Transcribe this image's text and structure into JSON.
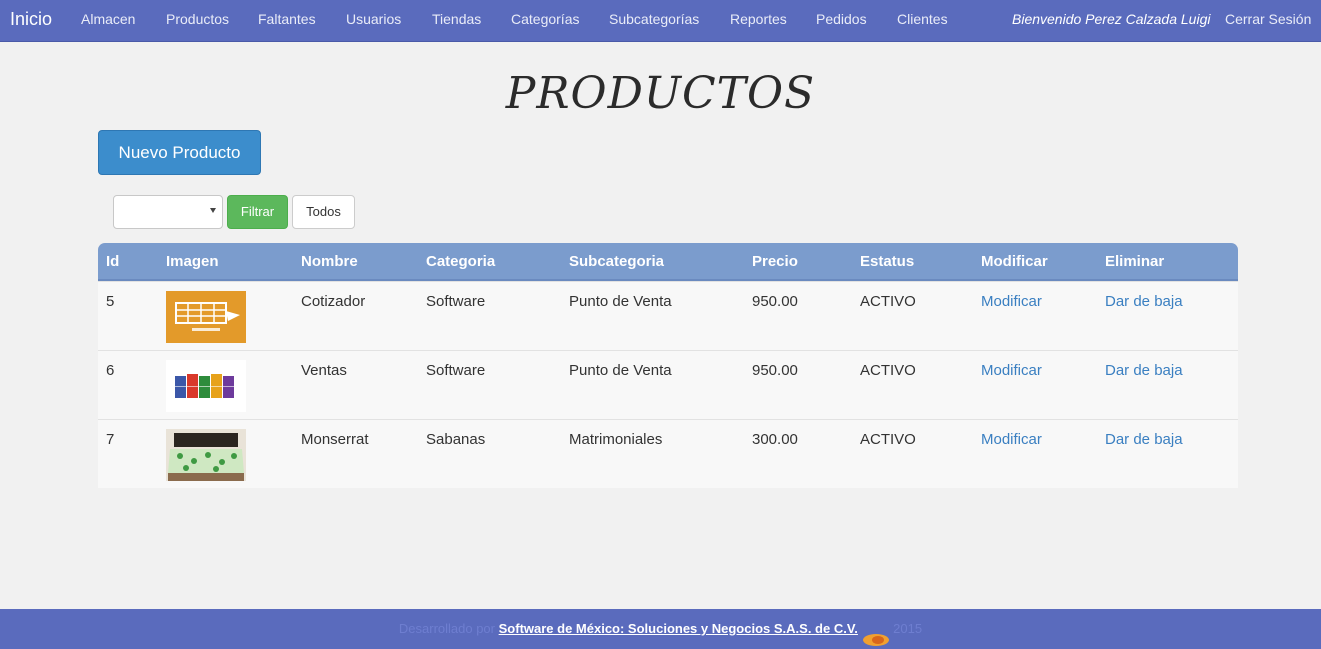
{
  "navbar": {
    "brand": "Inicio",
    "items": [
      "Almacen",
      "Productos",
      "Faltantes",
      "Usuarios",
      "Tiendas",
      "Categorías",
      "Subcategorías",
      "Reportes",
      "Pedidos",
      "Clientes"
    ],
    "welcome": "Bienvenido Perez Calzada Luigi",
    "logout": "Cerrar Sesión",
    "color": "#5a6bbd"
  },
  "page": {
    "title": "PRODUCTOS",
    "new_button": "Nuevo Producto"
  },
  "filter": {
    "selected": "",
    "filter_button": "Filtrar",
    "all_button": "Todos"
  },
  "table": {
    "headers": [
      "Id",
      "Imagen",
      "Nombre",
      "Categoria",
      "Subcategoria",
      "Precio",
      "Estatus",
      "Modificar",
      "Eliminar"
    ],
    "rows": [
      {
        "id": "5",
        "image": "cotizador-image",
        "nombre": "Cotizador",
        "categoria": "Software",
        "subcategoria": "Punto de Venta",
        "precio": "950.00",
        "estatus": "ACTIVO",
        "modificar": "Modificar",
        "eliminar": "Dar de baja"
      },
      {
        "id": "6",
        "image": "ventas-image",
        "nombre": "Ventas",
        "categoria": "Software",
        "subcategoria": "Punto de Venta",
        "precio": "950.00",
        "estatus": "ACTIVO",
        "modificar": "Modificar",
        "eliminar": "Dar de baja"
      },
      {
        "id": "7",
        "image": "bed-sheet-image",
        "nombre": "Monserrat",
        "categoria": "Sabanas",
        "subcategoria": "Matrimoniales",
        "precio": "300.00",
        "estatus": "ACTIVO",
        "modificar": "Modificar",
        "eliminar": "Dar de baja"
      }
    ]
  },
  "footer": {
    "prefix": "Desarrollado por",
    "company": "Software de México: Soluciones y Negocios S.A.S. de C.V.",
    "year": "2015"
  }
}
